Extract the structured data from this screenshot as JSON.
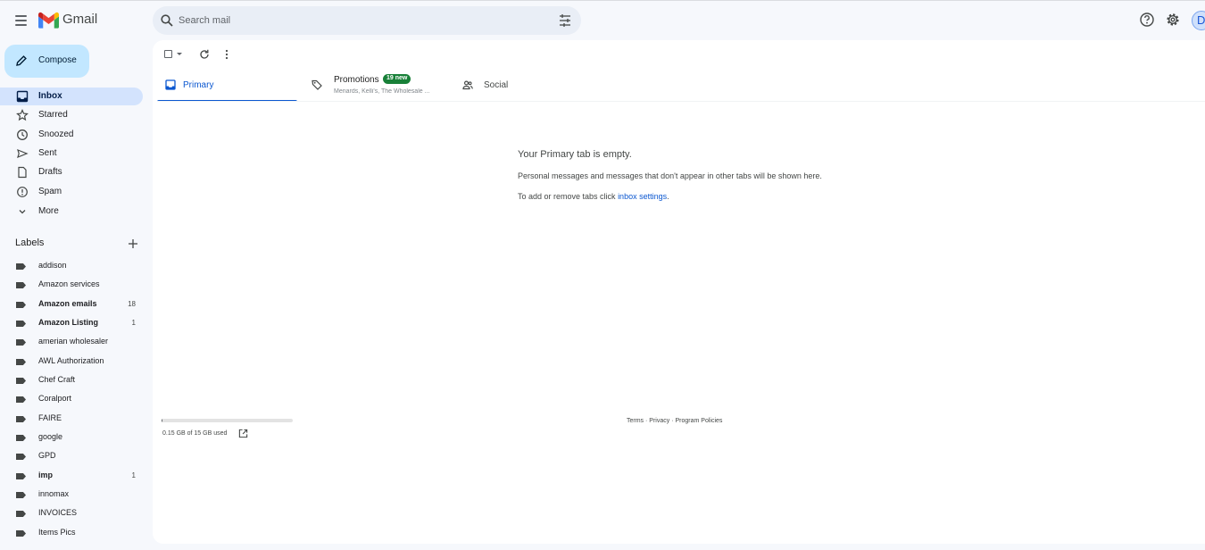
{
  "header": {
    "brand": "Gmail",
    "search_placeholder": "Search mail",
    "avatar_initial": "D"
  },
  "compose": {
    "label": "Compose"
  },
  "nav": [
    {
      "label": "Inbox",
      "icon": "inbox-icon",
      "active": true
    },
    {
      "label": "Starred",
      "icon": "star-icon"
    },
    {
      "label": "Snoozed",
      "icon": "clock-icon"
    },
    {
      "label": "Sent",
      "icon": "send-icon"
    },
    {
      "label": "Drafts",
      "icon": "draft-icon"
    },
    {
      "label": "Spam",
      "icon": "spam-icon"
    },
    {
      "label": "More",
      "icon": "chevron-down-icon"
    }
  ],
  "labels": {
    "heading": "Labels",
    "items": [
      {
        "label": "addison",
        "count": ""
      },
      {
        "label": "Amazon services",
        "count": ""
      },
      {
        "label": "Amazon emails",
        "count": "18",
        "bold": true
      },
      {
        "label": "Amazon Listing",
        "count": "1",
        "bold": true
      },
      {
        "label": "amerian wholesaler",
        "count": ""
      },
      {
        "label": "AWL Authorization",
        "count": ""
      },
      {
        "label": "Chef Craft",
        "count": ""
      },
      {
        "label": "Coralport",
        "count": ""
      },
      {
        "label": "FAIRE",
        "count": ""
      },
      {
        "label": "google",
        "count": ""
      },
      {
        "label": "GPD",
        "count": ""
      },
      {
        "label": "imp",
        "count": "1",
        "bold": true
      },
      {
        "label": "innomax",
        "count": ""
      },
      {
        "label": "INVOICES",
        "count": ""
      },
      {
        "label": "Items Pics",
        "count": ""
      }
    ]
  },
  "tabs": {
    "primary": {
      "label": "Primary"
    },
    "promotions": {
      "label": "Promotions",
      "badge": "19 new",
      "senders": "Menards, Kelli's, The Wholesale ..."
    },
    "social": {
      "label": "Social"
    }
  },
  "empty_state": {
    "title": "Your Primary tab is empty.",
    "line1": "Personal messages and messages that don't appear in other tabs will be shown here.",
    "line2_prefix": "To add or remove tabs click ",
    "line2_link": "inbox settings",
    "line2_suffix": "."
  },
  "storage": {
    "text": "0.15 GB of 15 GB used",
    "used_fraction": 0.01
  },
  "footer": {
    "terms": "Terms",
    "sep": " · ",
    "privacy": "Privacy",
    "policies": "Program Policies"
  },
  "colors": {
    "accent": "#0b57d0",
    "compose_bg": "#c2e7ff",
    "active_nav": "#d3e3fd",
    "badge": "#188038"
  }
}
